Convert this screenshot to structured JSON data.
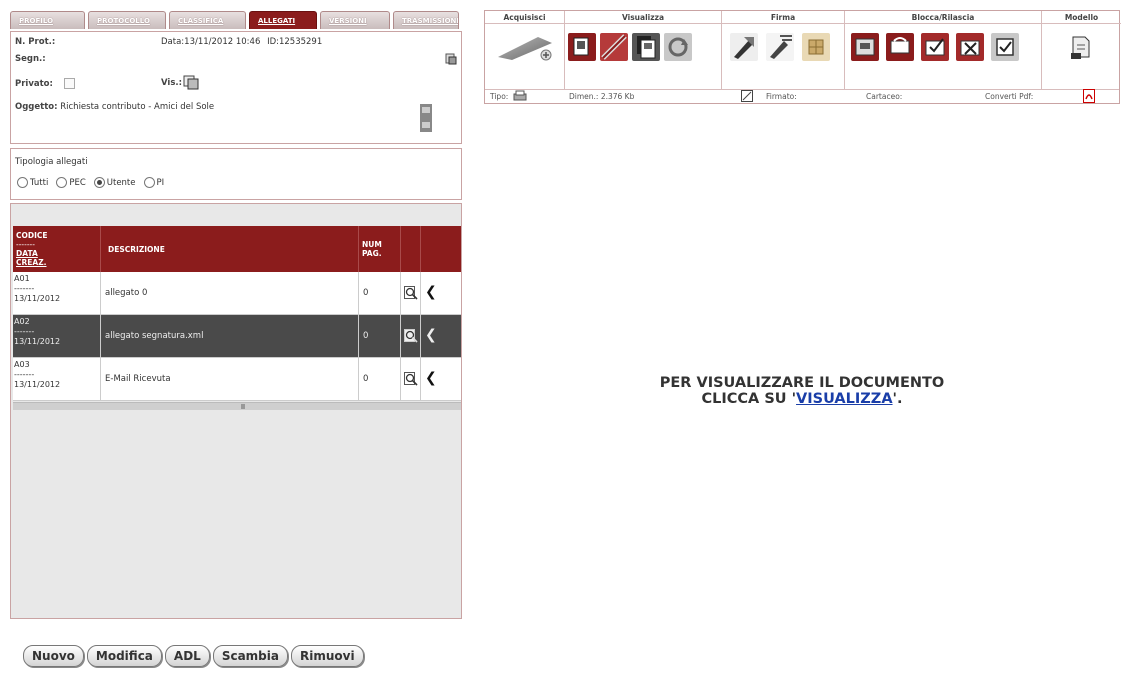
{
  "tabs": [
    {
      "label": "PROFILO",
      "active": false
    },
    {
      "label": "PROTOCOLLO",
      "active": false
    },
    {
      "label": "CLASSIFICA",
      "active": false
    },
    {
      "label": "ALLEGATI",
      "active": true
    },
    {
      "label": "VERSIONI",
      "active": false
    },
    {
      "label": "TRASMISSIONI",
      "active": false
    }
  ],
  "info": {
    "prot_label": "N. Prot.:",
    "data_text": "Data:13/11/2012 10:46",
    "id_text": "ID:12535291",
    "segn_label": "Segn.:",
    "privato_label": "Privato:",
    "vis_label": "Vis.:",
    "oggetto_label": "Oggetto:",
    "oggetto_value": "Richiesta contributo - Amici del Sole"
  },
  "tipologia": {
    "title": "Tipologia allegati",
    "options": [
      {
        "label": "Tutti",
        "selected": false
      },
      {
        "label": "PEC",
        "selected": false
      },
      {
        "label": "Utente",
        "selected": true
      },
      {
        "label": "PI",
        "selected": false
      }
    ]
  },
  "table": {
    "header": {
      "codice": "CODICE",
      "sep": "-------",
      "data": "DATA",
      "creaz": "CREAZ.",
      "descrizione": "DESCRIZIONE",
      "num": "NUM",
      "pag": "PAG."
    },
    "rows": [
      {
        "codice": "A01",
        "sep": "-------",
        "data": "13/11/2012",
        "descrizione": "allegato 0",
        "num_pag": "0"
      },
      {
        "codice": "A02",
        "sep": "-------",
        "data": "13/11/2012",
        "descrizione": "allegato segnatura.xml",
        "num_pag": "0"
      },
      {
        "codice": "A03",
        "sep": "-------",
        "data": "13/11/2012",
        "descrizione": "E-Mail Ricevuta",
        "num_pag": "0"
      }
    ]
  },
  "buttons": {
    "nuovo": "Nuovo",
    "modifica": "Modifica",
    "adl": "ADL",
    "scambia": "Scambia",
    "rimuovi": "Rimuovi"
  },
  "toolbar": {
    "acquisisci": "Acquisisci",
    "visualizza": "Visualizza",
    "firma": "Firma",
    "blocca": "Blocca/Rilascia",
    "modello": "Modello",
    "tipo_label": "Tipo:",
    "dimen_label": "Dimen.: 2.376 Kb",
    "firmato_label": "Firmato:",
    "cartaceo_label": "Cartaceo:",
    "converti_label": "Converti Pdf:"
  },
  "message": {
    "line1": "PER VISUALIZZARE IL DOCUMENTO",
    "prefix": "CLICCA SU '",
    "link": "VISUALIZZA",
    "suffix": "'."
  },
  "colors": {
    "accent": "#8b1c1c",
    "selected_row": "#4a4a4a",
    "link": "#1a3ea8"
  }
}
